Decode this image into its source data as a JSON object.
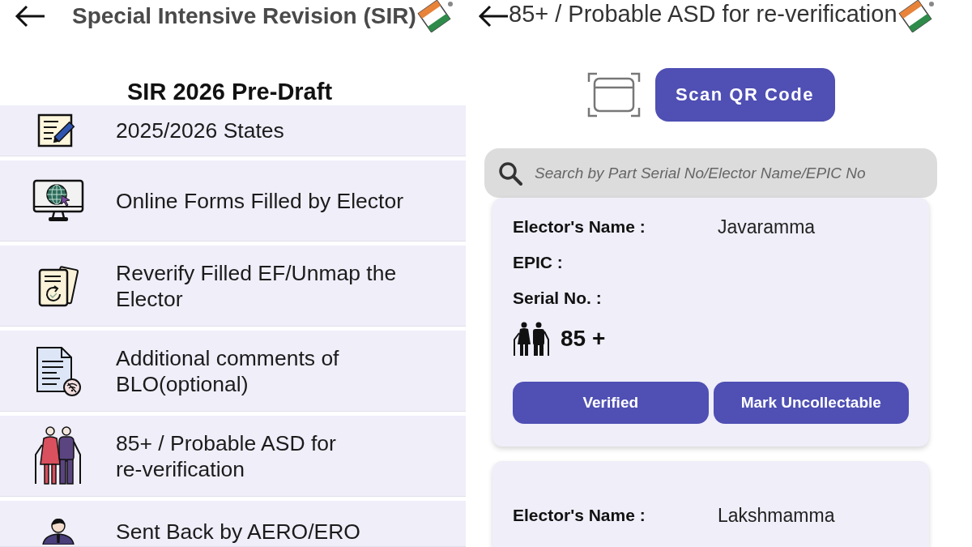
{
  "left_screen": {
    "header": {
      "title": "Special Intensive Revision (SIR)"
    },
    "subtitle": "SIR 2026 Pre-Draft",
    "menu_items": [
      {
        "label": "2025/2026 States"
      },
      {
        "label": "Online Forms Filled by Elector"
      },
      {
        "label": "Reverify Filled EF/Unmap the Elector"
      },
      {
        "label": "Additional comments of BLO(optional)"
      },
      {
        "label": "85+ / Probable ASD for re-verification"
      },
      {
        "label": "Sent Back by AERO/ERO"
      }
    ]
  },
  "right_screen": {
    "header": {
      "title": "85+ / Probable ASD for re-verification"
    },
    "scan_button": "Scan QR Code",
    "search": {
      "placeholder": "Search by Part Serial No/Elector Name/EPIC No"
    },
    "electors": [
      {
        "fields": [
          {
            "label": "Elector's Name :",
            "value": "Javaramma"
          },
          {
            "label": "EPIC :"
          },
          {
            "label": "Serial No. :"
          }
        ],
        "age_group": "85 +",
        "actions": [
          "Verified",
          "Mark Uncollectable"
        ]
      },
      {
        "fields": [
          {
            "label": "Elector's Name :",
            "value": "Lakshmamma"
          }
        ]
      }
    ]
  }
}
